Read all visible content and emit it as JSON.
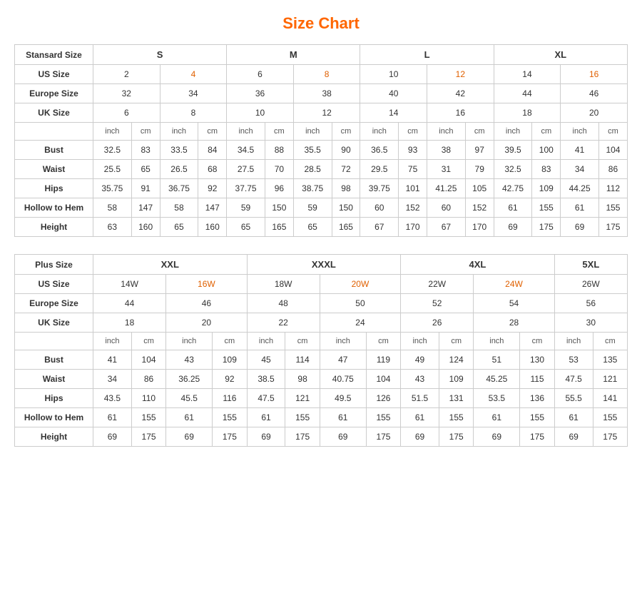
{
  "title": "Size Chart",
  "standard": {
    "label": "Stansard Size",
    "groups": [
      {
        "name": "S",
        "cols": 2
      },
      {
        "name": "M",
        "cols": 2
      },
      {
        "name": "L",
        "cols": 2
      },
      {
        "name": "XL",
        "cols": 2
      }
    ],
    "us_size": {
      "label": "US Size",
      "values": [
        "2",
        "4",
        "6",
        "8",
        "10",
        "12",
        "14",
        "16"
      ]
    },
    "europe_size": {
      "label": "Europe Size",
      "values": [
        "32",
        "34",
        "36",
        "38",
        "40",
        "42",
        "44",
        "46"
      ]
    },
    "uk_size": {
      "label": "UK Size",
      "values": [
        "6",
        "8",
        "10",
        "12",
        "14",
        "16",
        "18",
        "20"
      ]
    },
    "unit_row": [
      "inch",
      "cm",
      "inch",
      "cm",
      "inch",
      "cm",
      "inch",
      "cm",
      "inch",
      "cm",
      "inch",
      "cm",
      "inch",
      "cm",
      "inch",
      "cm"
    ],
    "measurements": [
      {
        "label": "Bust",
        "values": [
          "32.5",
          "83",
          "33.5",
          "84",
          "34.5",
          "88",
          "35.5",
          "90",
          "36.5",
          "93",
          "38",
          "97",
          "39.5",
          "100",
          "41",
          "104"
        ]
      },
      {
        "label": "Waist",
        "values": [
          "25.5",
          "65",
          "26.5",
          "68",
          "27.5",
          "70",
          "28.5",
          "72",
          "29.5",
          "75",
          "31",
          "79",
          "32.5",
          "83",
          "34",
          "86"
        ]
      },
      {
        "label": "Hips",
        "values": [
          "35.75",
          "91",
          "36.75",
          "92",
          "37.75",
          "96",
          "38.75",
          "98",
          "39.75",
          "101",
          "41.25",
          "105",
          "42.75",
          "109",
          "44.25",
          "112"
        ]
      },
      {
        "label": "Hollow to Hem",
        "values": [
          "58",
          "147",
          "58",
          "147",
          "59",
          "150",
          "59",
          "150",
          "60",
          "152",
          "60",
          "152",
          "61",
          "155",
          "61",
          "155"
        ]
      },
      {
        "label": "Height",
        "values": [
          "63",
          "160",
          "65",
          "160",
          "65",
          "165",
          "65",
          "165",
          "67",
          "170",
          "67",
          "170",
          "69",
          "175",
          "69",
          "175"
        ]
      }
    ]
  },
  "plus": {
    "label": "Plus Size",
    "groups": [
      {
        "name": "XXL",
        "cols": 2
      },
      {
        "name": "XXXL",
        "cols": 2
      },
      {
        "name": "4XL",
        "cols": 2
      },
      {
        "name": "5XL",
        "cols": 1
      }
    ],
    "us_size": {
      "label": "US Size",
      "values": [
        "14W",
        "16W",
        "18W",
        "20W",
        "22W",
        "24W",
        "26W"
      ]
    },
    "europe_size": {
      "label": "Europe Size",
      "values": [
        "44",
        "46",
        "48",
        "50",
        "52",
        "54",
        "56"
      ]
    },
    "uk_size": {
      "label": "UK Size",
      "values": [
        "18",
        "20",
        "22",
        "24",
        "26",
        "28",
        "30"
      ]
    },
    "unit_row": [
      "inch",
      "cm",
      "inch",
      "cm",
      "inch",
      "cm",
      "inch",
      "cm",
      "inch",
      "cm",
      "inch",
      "cm",
      "inch",
      "cm"
    ],
    "measurements": [
      {
        "label": "Bust",
        "values": [
          "41",
          "104",
          "43",
          "109",
          "45",
          "114",
          "47",
          "119",
          "49",
          "124",
          "51",
          "130",
          "53",
          "135"
        ]
      },
      {
        "label": "Waist",
        "values": [
          "34",
          "86",
          "36.25",
          "92",
          "38.5",
          "98",
          "40.75",
          "104",
          "43",
          "109",
          "45.25",
          "115",
          "47.5",
          "121"
        ]
      },
      {
        "label": "Hips",
        "values": [
          "43.5",
          "110",
          "45.5",
          "116",
          "47.5",
          "121",
          "49.5",
          "126",
          "51.5",
          "131",
          "53.5",
          "136",
          "55.5",
          "141"
        ]
      },
      {
        "label": "Hollow to Hem",
        "values": [
          "61",
          "155",
          "61",
          "155",
          "61",
          "155",
          "61",
          "155",
          "61",
          "155",
          "61",
          "155",
          "61",
          "155"
        ]
      },
      {
        "label": "Height",
        "values": [
          "69",
          "175",
          "69",
          "175",
          "69",
          "175",
          "69",
          "175",
          "69",
          "175",
          "69",
          "175",
          "69",
          "175"
        ]
      }
    ]
  }
}
